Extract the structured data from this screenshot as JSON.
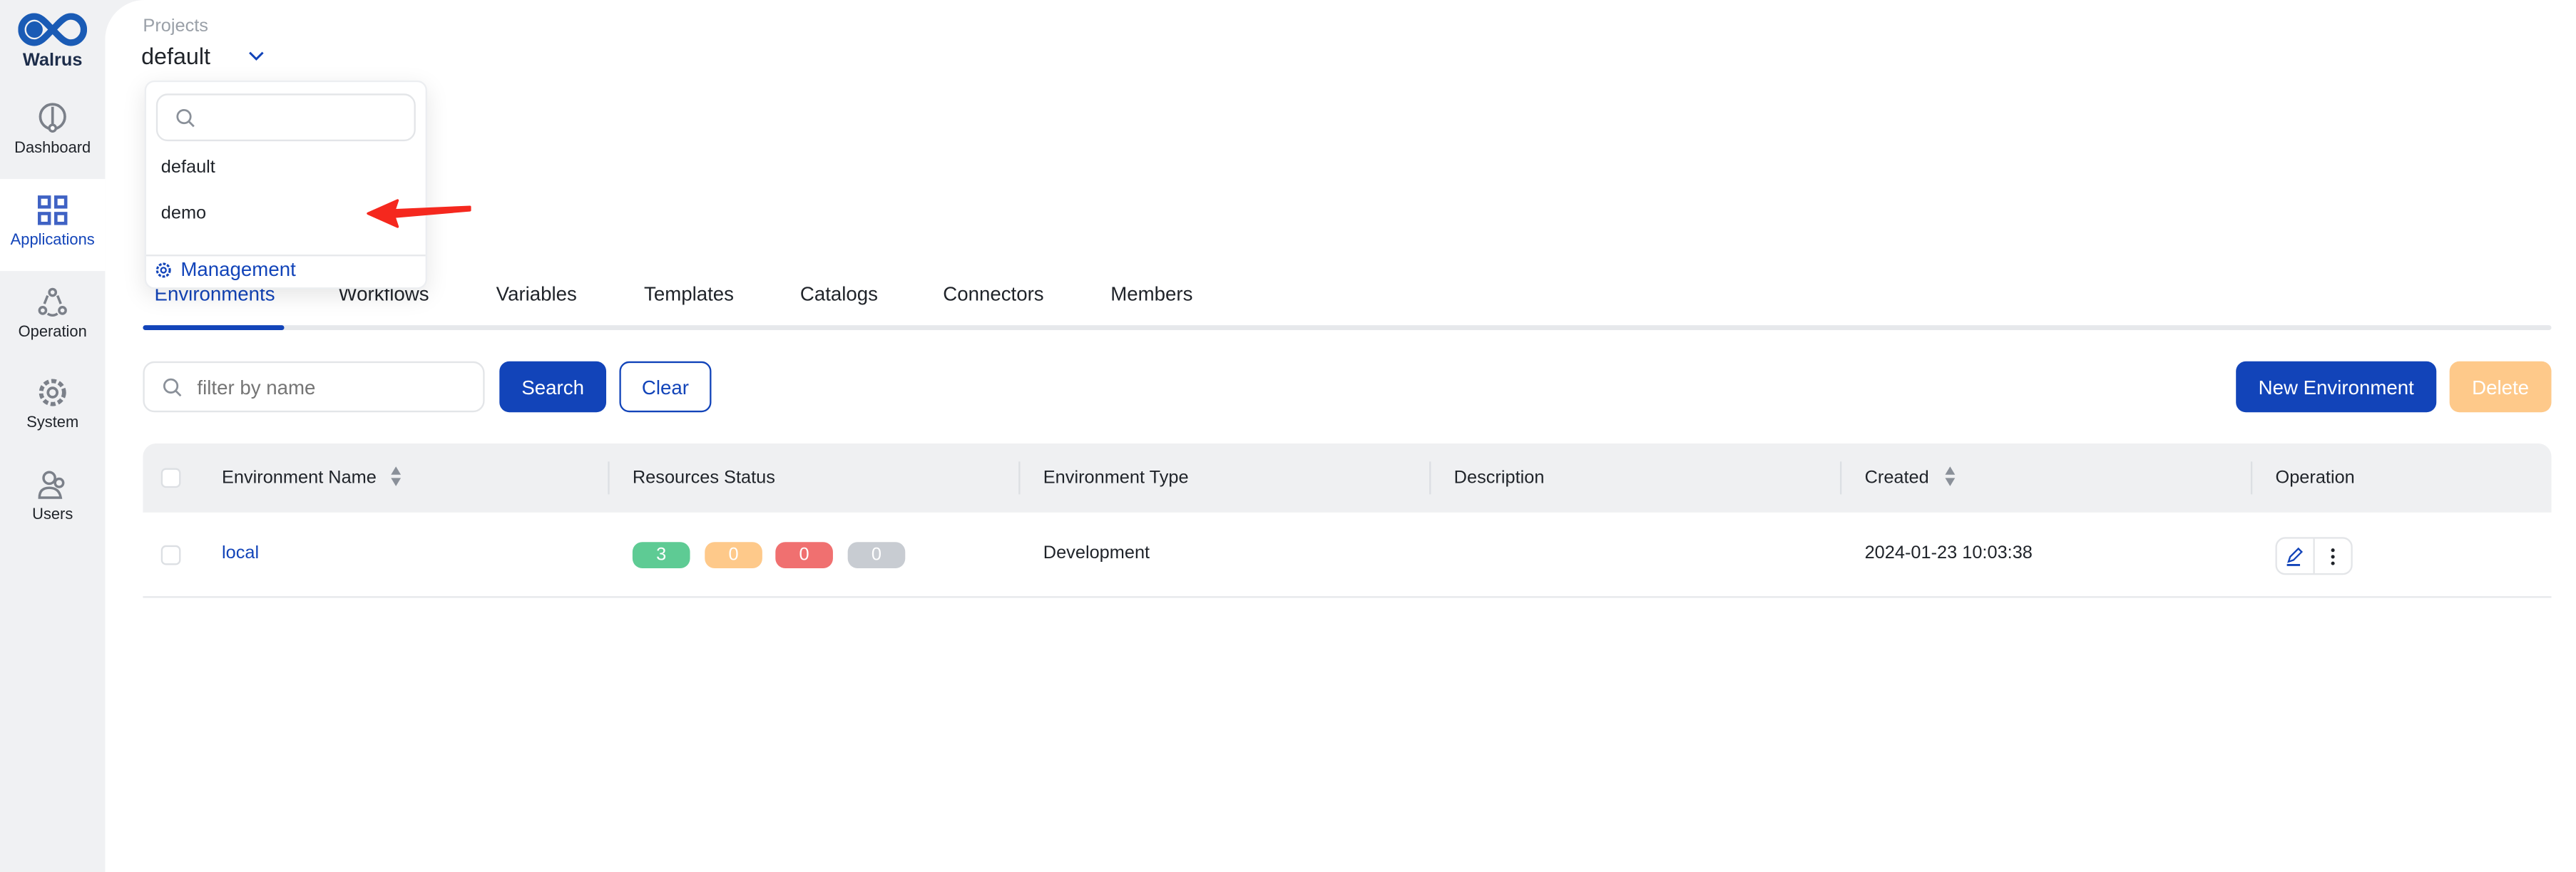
{
  "app": {
    "name": "Walrus"
  },
  "sidebar": {
    "items": [
      {
        "label": "Dashboard",
        "icon": "dashboard-icon",
        "active": false
      },
      {
        "label": "Applications",
        "icon": "grid-icon",
        "active": true
      },
      {
        "label": "Operation",
        "icon": "operation-icon",
        "active": false
      },
      {
        "label": "System",
        "icon": "gear-icon",
        "active": false
      },
      {
        "label": "Users",
        "icon": "users-icon",
        "active": false
      }
    ]
  },
  "project": {
    "label": "Projects",
    "selected": "default"
  },
  "dropdown": {
    "search_placeholder": "",
    "options": [
      "default",
      "demo"
    ],
    "management_label": "Management"
  },
  "tabs": [
    {
      "label": "Environments",
      "active": true
    },
    {
      "label": "Workflows"
    },
    {
      "label": "Variables"
    },
    {
      "label": "Templates"
    },
    {
      "label": "Catalogs"
    },
    {
      "label": "Connectors"
    },
    {
      "label": "Members"
    }
  ],
  "toolbar": {
    "filter_placeholder": "filter by name",
    "search_label": "Search",
    "clear_label": "Clear",
    "new_label": "New Environment",
    "delete_label": "Delete"
  },
  "table": {
    "columns": [
      "Environment Name",
      "Resources Status",
      "Environment Type",
      "Description",
      "Created",
      "Operation"
    ],
    "rows": [
      {
        "name": "local",
        "status": {
          "ready": "3",
          "transitioning": "0",
          "error": "0",
          "inactive": "0"
        },
        "type": "Development",
        "description": "",
        "created": "2024-01-23 10:03:38"
      }
    ]
  },
  "colors": {
    "primary": "#1244b9",
    "ready": "#5ecb94",
    "transitioning": "#fec98a",
    "error": "#f07070",
    "inactive": "#c8ccd2",
    "annotation_arrow": "#f5281e"
  }
}
